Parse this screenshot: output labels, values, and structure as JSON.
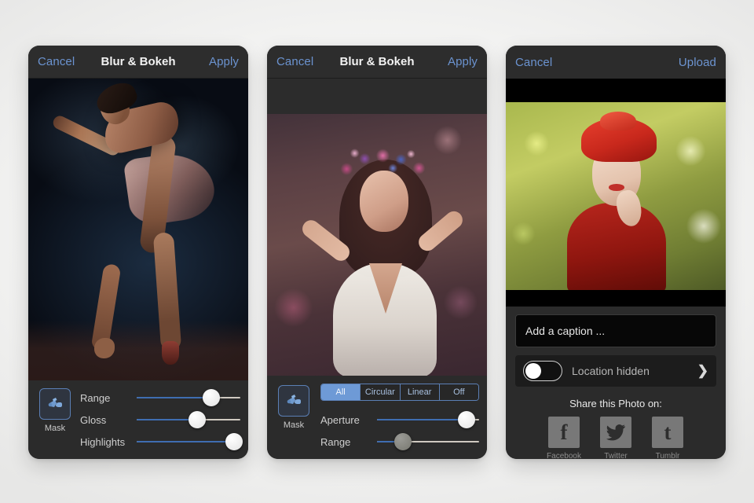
{
  "phone1": {
    "nav": {
      "left": "Cancel",
      "title": "Blur & Bokeh",
      "right": "Apply"
    },
    "photo_alt": "ballet-dancer-dark-stage",
    "mask": {
      "label": "Mask",
      "icon": "airbrush-icon"
    },
    "sliders": [
      {
        "label": "Range",
        "value": 72
      },
      {
        "label": "Gloss",
        "value": 58
      },
      {
        "label": "Highlights",
        "value": 94
      }
    ]
  },
  "phone2": {
    "nav": {
      "left": "Cancel",
      "title": "Blur & Bokeh",
      "right": "Apply"
    },
    "photo_alt": "woman-with-flower-crown",
    "mask": {
      "label": "Mask",
      "icon": "airbrush-icon"
    },
    "segments": [
      {
        "label": "All",
        "active": true
      },
      {
        "label": "Circular",
        "active": false
      },
      {
        "label": "Linear",
        "active": false
      },
      {
        "label": "Off",
        "active": false
      }
    ],
    "sliders": [
      {
        "label": "Aperture",
        "value": 88
      },
      {
        "label": "Range",
        "value": 25
      }
    ]
  },
  "phone3": {
    "nav": {
      "left": "Cancel",
      "right": "Upload"
    },
    "photo_alt": "woman-with-red-turban",
    "caption_placeholder": "Add a caption ...",
    "location": {
      "label": "Location hidden",
      "enabled": false,
      "chevron": "❯"
    },
    "share_title": "Share this Photo on:",
    "share": [
      {
        "name": "Facebook",
        "glyph": "f",
        "icon": "facebook-icon"
      },
      {
        "name": "Twitter",
        "glyph": "🐦",
        "icon": "twitter-icon"
      },
      {
        "name": "Tumblr",
        "glyph": "t",
        "icon": "tumblr-icon"
      }
    ]
  },
  "colors": {
    "accent_blue": "#6b93d0",
    "slider_fill": "#3f6db1",
    "segment_active": "#6e9ad6",
    "panel_bg": "#2b2b2b",
    "page_bg": "#f2f2f1"
  }
}
